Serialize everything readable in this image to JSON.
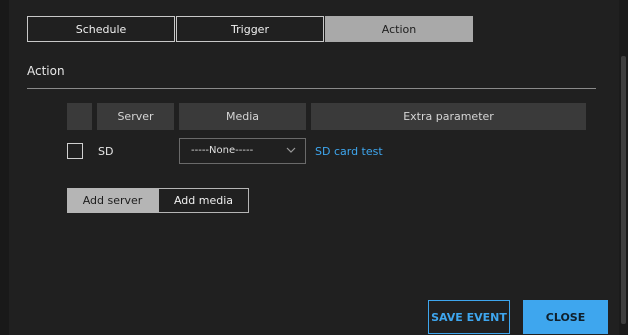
{
  "tabs": [
    {
      "label": "Schedule",
      "active": false
    },
    {
      "label": "Trigger",
      "active": false
    },
    {
      "label": "Action",
      "active": true
    }
  ],
  "section": {
    "title": "Action"
  },
  "table": {
    "headers": {
      "check": "",
      "server": "Server",
      "media": "Media",
      "extra": "Extra parameter"
    },
    "rows": [
      {
        "checked": false,
        "server": "SD",
        "media": "-----None-----",
        "extra": "SD card test"
      }
    ]
  },
  "buttons": {
    "add_server": "Add server",
    "add_media": "Add media",
    "save_event": "SAVE EVENT",
    "close": "CLOSE"
  },
  "icons": {
    "media_dropdown": "chevron-down-icon"
  },
  "colors": {
    "accent": "#3ea6ee",
    "background": "#202020",
    "header_cell": "#3a3a3a",
    "active_tab": "#a9a9a9"
  }
}
